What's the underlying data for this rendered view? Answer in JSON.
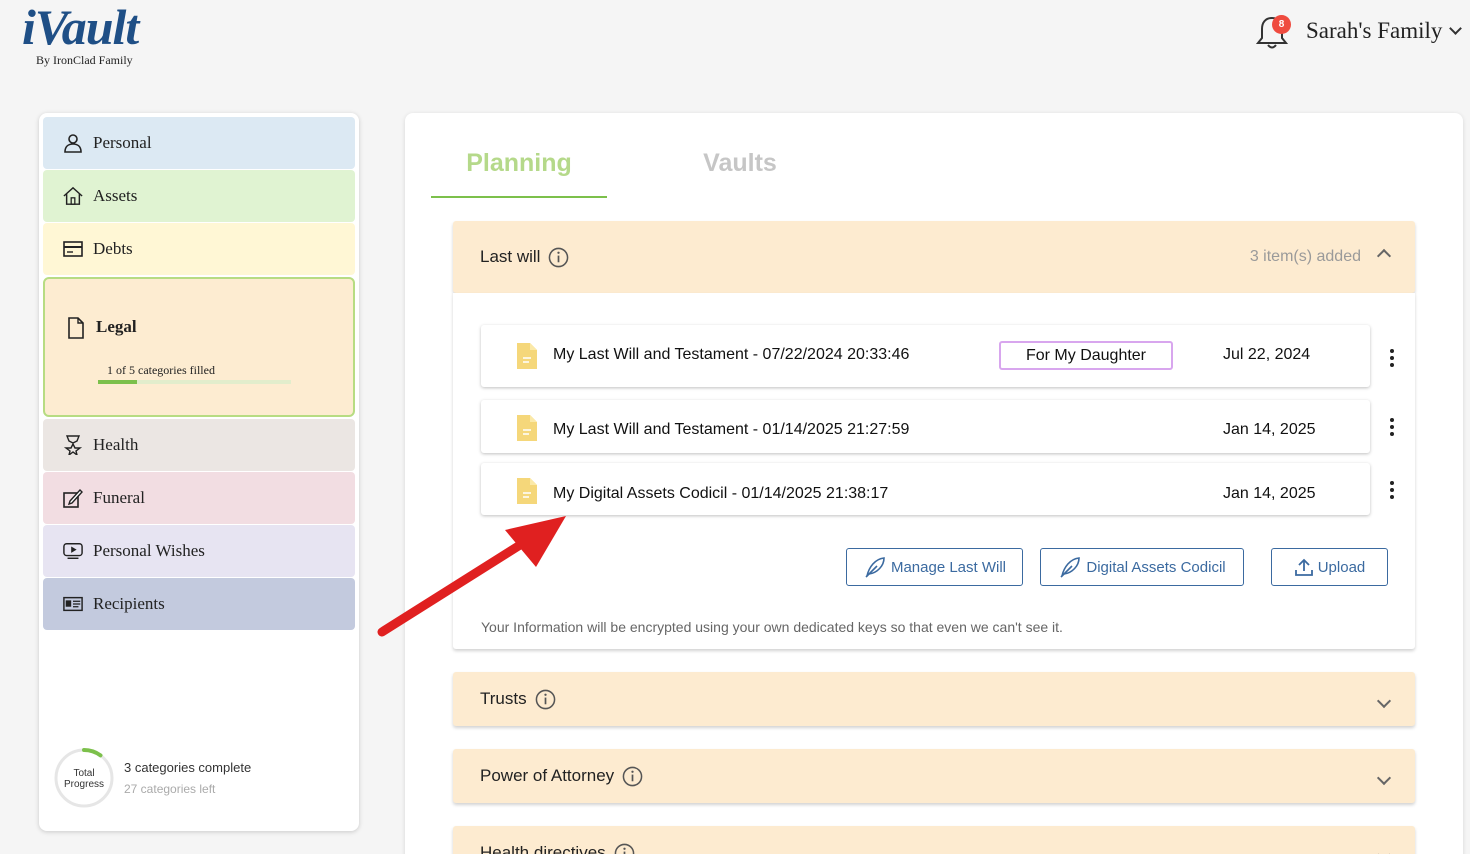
{
  "header": {
    "logo_text": "iVault",
    "logo_sub": "By IronClad Family",
    "notifications_count": "8",
    "account_label": "Sarah's Family"
  },
  "sidebar": {
    "items": [
      {
        "label": "Personal",
        "icon": "person-icon",
        "color": "#dce9f3"
      },
      {
        "label": "Assets",
        "icon": "home-icon",
        "color": "#e0f3d2"
      },
      {
        "label": "Debts",
        "icon": "card-icon",
        "color": "#fff7d5"
      },
      {
        "label": "Legal",
        "icon": "document-icon",
        "color": "#fdecd1",
        "status": "1 of 5 categories filled",
        "progress": 0.2
      },
      {
        "label": "Health",
        "icon": "health-icon",
        "color": "#ebe6e3"
      },
      {
        "label": "Funeral",
        "icon": "edit-icon",
        "color": "#f2dde2"
      },
      {
        "label": "Personal Wishes",
        "icon": "video-icon",
        "color": "#e7e4f2"
      },
      {
        "label": "Recipients",
        "icon": "id-card-icon",
        "color": "#c3cade"
      }
    ],
    "total_progress_label": "Total Progress",
    "complete_text": "3 categories complete",
    "left_text": "27 categories left",
    "progress_fraction": 0.1
  },
  "tabs": {
    "planning": "Planning",
    "vaults": "Vaults"
  },
  "last_will": {
    "title": "Last will",
    "count": "3 item(s) added",
    "documents": [
      {
        "name": "My Last Will and Testament - 07/22/2024 20:33:46",
        "tag": "For My Daughter",
        "date": "Jul 22, 2024"
      },
      {
        "name": "My Last Will and Testament - 01/14/2025 21:27:59",
        "date": "Jan 14, 2025"
      },
      {
        "name": "My Digital Assets Codicil - 01/14/2025 21:38:17",
        "date": "Jan 14, 2025"
      }
    ],
    "buttons": {
      "manage": "Manage Last Will",
      "codicil": "Digital Assets Codicil",
      "upload": "Upload"
    },
    "note": "Your Information will be encrypted using your own dedicated keys so that even we can't see it."
  },
  "sections": {
    "trusts": "Trusts",
    "poa": "Power of Attorney",
    "health": "Health directives"
  },
  "colors": {
    "accent_green": "#7cc04b",
    "section_bg": "#fdebd0",
    "button_blue": "#3b6aa0",
    "annotation_arrow": "#e02020"
  }
}
